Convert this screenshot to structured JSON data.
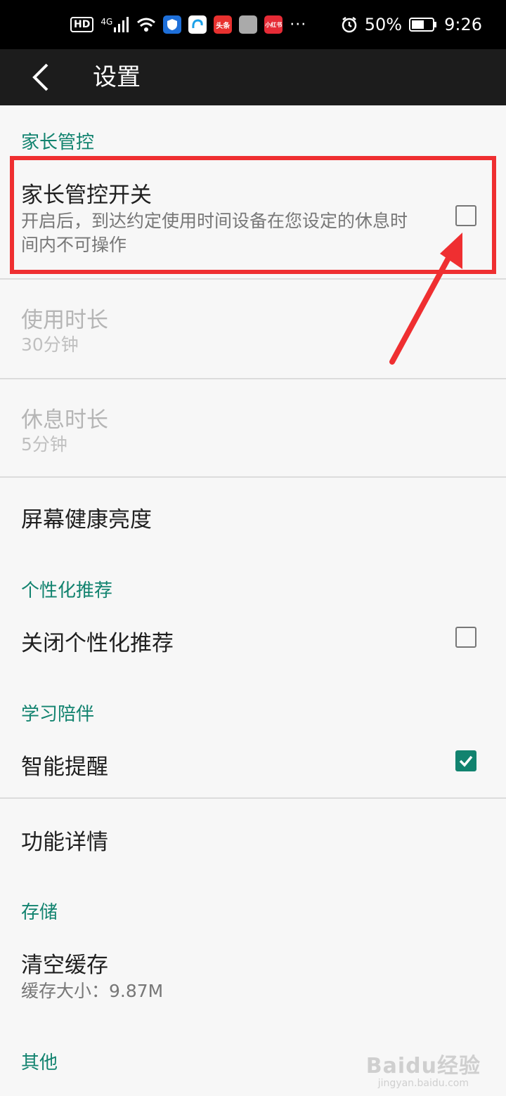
{
  "status_bar": {
    "network": "4G",
    "hd": "HD",
    "app_badges": [
      "头条",
      "小红书"
    ],
    "more": "···",
    "battery_percent": "50%",
    "time": "9:26"
  },
  "toolbar": {
    "title": "设置"
  },
  "sections": {
    "parental": "家长管控",
    "personal": "个性化推荐",
    "study": "学习陪伴",
    "storage": "存储",
    "other": "其他"
  },
  "items": {
    "parental_switch": {
      "title": "家长管控开关",
      "subtitle": "开启后，到达约定使用时间设备在您设定的休息时间内不可操作",
      "checked": false
    },
    "usage_duration": {
      "title": "使用时长",
      "value": "30分钟"
    },
    "rest_duration": {
      "title": "休息时长",
      "value": "5分钟"
    },
    "screen_brightness": {
      "title": "屏幕健康亮度"
    },
    "close_personal": {
      "title": "关闭个性化推荐",
      "checked": false
    },
    "smart_reminder": {
      "title": "智能提醒",
      "checked": true
    },
    "feature_details": {
      "title": "功能详情"
    },
    "clear_cache": {
      "title": "清空缓存",
      "value": "缓存大小：9.87M"
    }
  },
  "watermark": {
    "brand": "Baidu经验",
    "url": "jingyan.baidu.com"
  },
  "colors": {
    "accent": "#12836f",
    "annotation": "#ef2f31",
    "toolbar": "#1c1c1c"
  }
}
